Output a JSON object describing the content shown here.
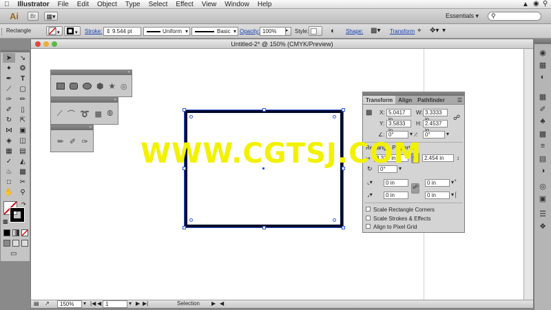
{
  "menubar": {
    "apple": "",
    "items": [
      "Illustrator",
      "File",
      "Edit",
      "Object",
      "Type",
      "Select",
      "Effect",
      "View",
      "Window",
      "Help"
    ]
  },
  "appbar": {
    "logo": "Ai",
    "bridge": "Br",
    "workspace": "Essentials ▾",
    "search_placeholder": ""
  },
  "control": {
    "selection_type": "Rectangle",
    "stroke_label": "Stroke:",
    "stroke_value": "9.544 pt",
    "profile_value": "Uniform",
    "brush_value": "Basic",
    "opacity_label": "Opacity:",
    "opacity_value": "100%",
    "style_label": "Style:",
    "shape_label": "Shape:",
    "transform_label": "Transform"
  },
  "document": {
    "title": "Untitled-2* @ 150% (CMYK/Preview)",
    "zoom": "150%",
    "artboard": "1",
    "status": "Selection"
  },
  "watermark": "WWW.CGTSJ.COM",
  "transform_panel": {
    "tabs": [
      "Transform",
      "Align",
      "Pathfinder"
    ],
    "x_label": "X:",
    "x_value": "5.0417 in",
    "y_label": "Y:",
    "y_value": "3.5833 in",
    "w_label": "W:",
    "w_value": "3.3333 in",
    "h_label": "H:",
    "h_value": "2.4537 in",
    "rotate_value": "0°",
    "shear_value": "0°",
    "rect_section": "Rectangle Properties:",
    "rect_w_value": "3.333 in",
    "rect_h_value": "2.454 in",
    "rect_angle_value": "0°",
    "corner_tl": "0 in",
    "corner_tr": "0 in",
    "corner_bl": "0 in",
    "corner_br": "0 in",
    "options": [
      "Scale Rectangle Corners",
      "Scale Strokes & Effects",
      "Align to Pixel Grid"
    ]
  }
}
